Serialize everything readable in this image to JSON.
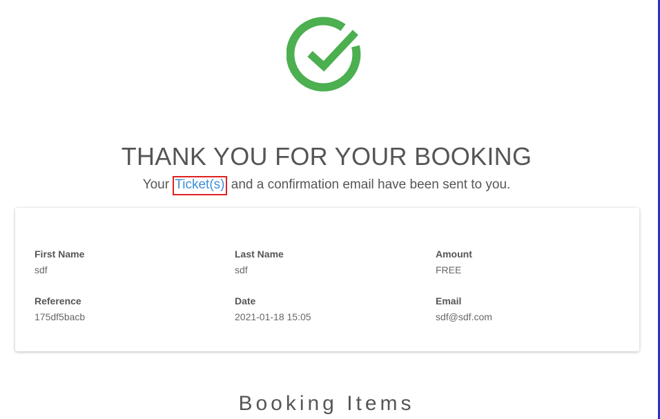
{
  "confirmation": {
    "title": "THANK YOU FOR YOUR BOOKING",
    "subtitle_before": "Your ",
    "ticket_link": "Ticket(s)",
    "subtitle_after": " and a confirmation email have been sent to you.",
    "icon": "check-circle-icon",
    "icon_color": "#4caf50"
  },
  "details": {
    "first_name": {
      "label": "First Name",
      "value": "sdf"
    },
    "last_name": {
      "label": "Last Name",
      "value": "sdf"
    },
    "amount": {
      "label": "Amount",
      "value": "FREE"
    },
    "reference": {
      "label": "Reference",
      "value": "175df5bacb"
    },
    "date": {
      "label": "Date",
      "value": "2021-01-18 15:05"
    },
    "email": {
      "label": "Email",
      "value": "sdf@sdf.com"
    }
  },
  "booking_items": {
    "heading": "Booking Items"
  },
  "colors": {
    "link": "#3b8fd6",
    "highlight_box": "#e02020",
    "window_border": "#2d2fc4"
  }
}
